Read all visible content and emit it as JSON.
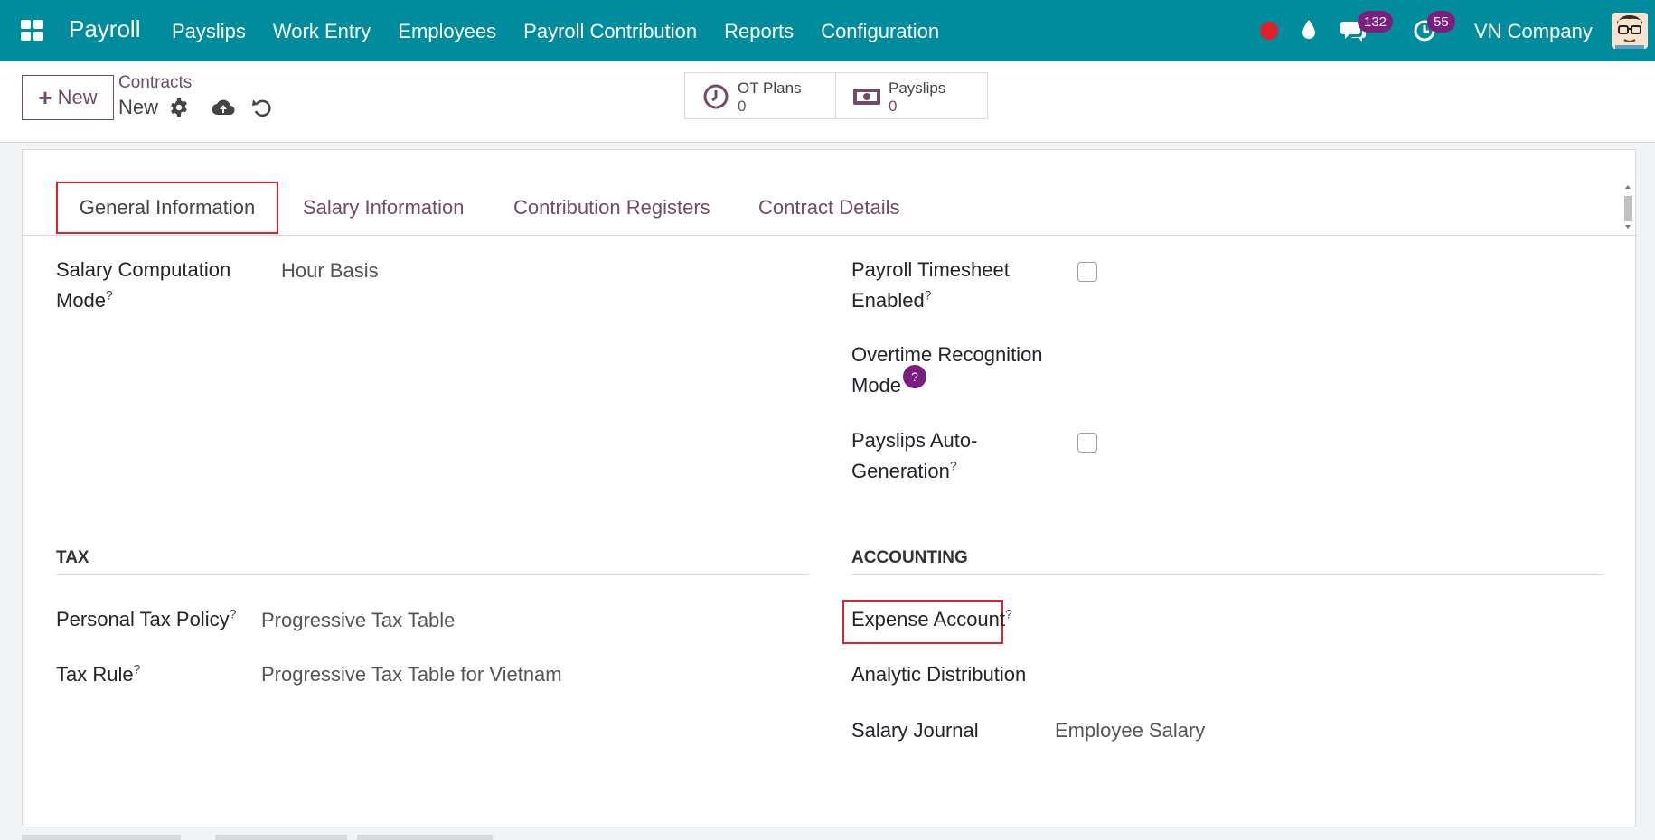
{
  "navbar": {
    "app_name": "Payroll",
    "menu": [
      "Payslips",
      "Work Entry",
      "Employees",
      "Payroll Contribution",
      "Reports",
      "Configuration"
    ],
    "chat_count": "132",
    "activity_count": "55",
    "company": "VN Company",
    "accent_color": "#008c9c"
  },
  "control": {
    "new_label": "New",
    "breadcrumb": "Contracts",
    "record_name": "New",
    "stats": [
      {
        "label": "OT Plans",
        "value": "0",
        "icon": "clock-icon"
      },
      {
        "label": "Payslips",
        "value": "0",
        "icon": "money-icon"
      }
    ]
  },
  "tabs": [
    "General Information",
    "Salary Information",
    "Contribution Registers",
    "Contract Details"
  ],
  "general": {
    "salary_mode_label_1": "Salary Computation",
    "salary_mode_label_2": "Mode",
    "salary_mode_value": "Hour Basis",
    "timesheet_label_1": "Payroll Timesheet",
    "timesheet_label_2": "Enabled",
    "overtime_label_1": "Overtime Recognition",
    "overtime_label_2": "Mode",
    "autogen_label_1": "Payslips Auto-",
    "autogen_label_2": "Generation"
  },
  "tax": {
    "title": "TAX",
    "policy_label": "Personal Tax Policy",
    "policy_value": "Progressive Tax Table",
    "rule_label": "Tax Rule",
    "rule_value": "Progressive Tax Table for Vietnam"
  },
  "accounting": {
    "title": "ACCOUNTING",
    "expense_label": "Expense Account",
    "analytic_label": "Analytic Distribution",
    "journal_label": "Salary Journal",
    "journal_value": "Employee Salary"
  },
  "help_mark": "?"
}
